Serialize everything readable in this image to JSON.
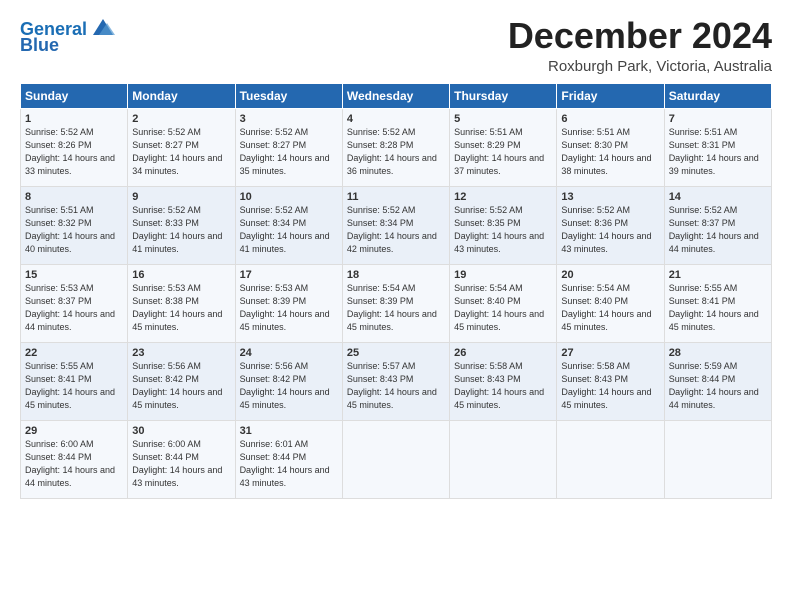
{
  "header": {
    "logo_line1": "General",
    "logo_line2": "Blue",
    "month": "December 2024",
    "location": "Roxburgh Park, Victoria, Australia"
  },
  "days_of_week": [
    "Sunday",
    "Monday",
    "Tuesday",
    "Wednesday",
    "Thursday",
    "Friday",
    "Saturday"
  ],
  "weeks": [
    [
      {
        "day": "1",
        "sunrise": "5:52 AM",
        "sunset": "8:26 PM",
        "daylight": "14 hours and 33 minutes."
      },
      {
        "day": "2",
        "sunrise": "5:52 AM",
        "sunset": "8:27 PM",
        "daylight": "14 hours and 34 minutes."
      },
      {
        "day": "3",
        "sunrise": "5:52 AM",
        "sunset": "8:27 PM",
        "daylight": "14 hours and 35 minutes."
      },
      {
        "day": "4",
        "sunrise": "5:52 AM",
        "sunset": "8:28 PM",
        "daylight": "14 hours and 36 minutes."
      },
      {
        "day": "5",
        "sunrise": "5:51 AM",
        "sunset": "8:29 PM",
        "daylight": "14 hours and 37 minutes."
      },
      {
        "day": "6",
        "sunrise": "5:51 AM",
        "sunset": "8:30 PM",
        "daylight": "14 hours and 38 minutes."
      },
      {
        "day": "7",
        "sunrise": "5:51 AM",
        "sunset": "8:31 PM",
        "daylight": "14 hours and 39 minutes."
      }
    ],
    [
      {
        "day": "8",
        "sunrise": "5:51 AM",
        "sunset": "8:32 PM",
        "daylight": "14 hours and 40 minutes."
      },
      {
        "day": "9",
        "sunrise": "5:52 AM",
        "sunset": "8:33 PM",
        "daylight": "14 hours and 41 minutes."
      },
      {
        "day": "10",
        "sunrise": "5:52 AM",
        "sunset": "8:34 PM",
        "daylight": "14 hours and 41 minutes."
      },
      {
        "day": "11",
        "sunrise": "5:52 AM",
        "sunset": "8:34 PM",
        "daylight": "14 hours and 42 minutes."
      },
      {
        "day": "12",
        "sunrise": "5:52 AM",
        "sunset": "8:35 PM",
        "daylight": "14 hours and 43 minutes."
      },
      {
        "day": "13",
        "sunrise": "5:52 AM",
        "sunset": "8:36 PM",
        "daylight": "14 hours and 43 minutes."
      },
      {
        "day": "14",
        "sunrise": "5:52 AM",
        "sunset": "8:37 PM",
        "daylight": "14 hours and 44 minutes."
      }
    ],
    [
      {
        "day": "15",
        "sunrise": "5:53 AM",
        "sunset": "8:37 PM",
        "daylight": "14 hours and 44 minutes."
      },
      {
        "day": "16",
        "sunrise": "5:53 AM",
        "sunset": "8:38 PM",
        "daylight": "14 hours and 45 minutes."
      },
      {
        "day": "17",
        "sunrise": "5:53 AM",
        "sunset": "8:39 PM",
        "daylight": "14 hours and 45 minutes."
      },
      {
        "day": "18",
        "sunrise": "5:54 AM",
        "sunset": "8:39 PM",
        "daylight": "14 hours and 45 minutes."
      },
      {
        "day": "19",
        "sunrise": "5:54 AM",
        "sunset": "8:40 PM",
        "daylight": "14 hours and 45 minutes."
      },
      {
        "day": "20",
        "sunrise": "5:54 AM",
        "sunset": "8:40 PM",
        "daylight": "14 hours and 45 minutes."
      },
      {
        "day": "21",
        "sunrise": "5:55 AM",
        "sunset": "8:41 PM",
        "daylight": "14 hours and 45 minutes."
      }
    ],
    [
      {
        "day": "22",
        "sunrise": "5:55 AM",
        "sunset": "8:41 PM",
        "daylight": "14 hours and 45 minutes."
      },
      {
        "day": "23",
        "sunrise": "5:56 AM",
        "sunset": "8:42 PM",
        "daylight": "14 hours and 45 minutes."
      },
      {
        "day": "24",
        "sunrise": "5:56 AM",
        "sunset": "8:42 PM",
        "daylight": "14 hours and 45 minutes."
      },
      {
        "day": "25",
        "sunrise": "5:57 AM",
        "sunset": "8:43 PM",
        "daylight": "14 hours and 45 minutes."
      },
      {
        "day": "26",
        "sunrise": "5:58 AM",
        "sunset": "8:43 PM",
        "daylight": "14 hours and 45 minutes."
      },
      {
        "day": "27",
        "sunrise": "5:58 AM",
        "sunset": "8:43 PM",
        "daylight": "14 hours and 45 minutes."
      },
      {
        "day": "28",
        "sunrise": "5:59 AM",
        "sunset": "8:44 PM",
        "daylight": "14 hours and 44 minutes."
      }
    ],
    [
      {
        "day": "29",
        "sunrise": "6:00 AM",
        "sunset": "8:44 PM",
        "daylight": "14 hours and 44 minutes."
      },
      {
        "day": "30",
        "sunrise": "6:00 AM",
        "sunset": "8:44 PM",
        "daylight": "14 hours and 43 minutes."
      },
      {
        "day": "31",
        "sunrise": "6:01 AM",
        "sunset": "8:44 PM",
        "daylight": "14 hours and 43 minutes."
      },
      null,
      null,
      null,
      null
    ]
  ]
}
